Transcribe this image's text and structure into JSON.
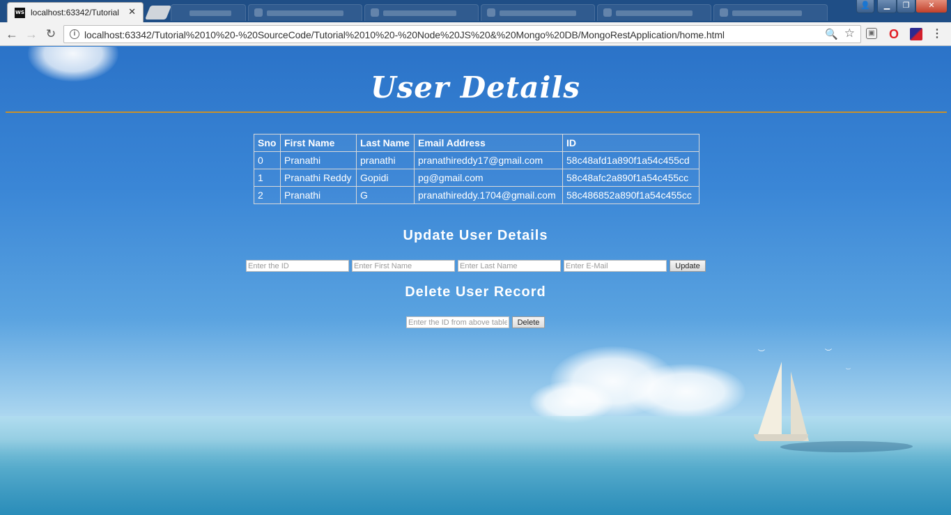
{
  "browser": {
    "active_tab": {
      "title": "localhost:63342/Tutorial",
      "favicon": "WS"
    },
    "url": "localhost:63342/Tutorial%2010%20-%20SourceCode/Tutorial%2010%20-%20Node%20JS%20&%20Mongo%20DB/MongoRestApplication/home.html",
    "icons": [
      "back-arrow-icon",
      "forward-arrow-icon",
      "reload-icon",
      "info-icon",
      "zoom-icon",
      "bookmark-star-icon",
      "opera-icon",
      "menu-icon"
    ]
  },
  "page": {
    "title": "User Details",
    "table": {
      "headers": [
        "Sno",
        "First Name",
        "Last Name",
        "Email Address",
        "ID"
      ],
      "rows": [
        [
          "0",
          "Pranathi",
          "pranathi",
          "pranathireddy17@gmail.com",
          "58c48afd1a890f1a54c455cd"
        ],
        [
          "1",
          "Pranathi Reddy",
          "Gopidi",
          "pg@gmail.com",
          "58c48afc2a890f1a54c455cc"
        ],
        [
          "2",
          "Pranathi",
          "G",
          "pranathireddy.1704@gmail.com",
          "58c486852a890f1a54c455cc"
        ]
      ]
    },
    "update": {
      "title": "Update User Details",
      "id_placeholder": "Enter the ID",
      "first_name_placeholder": "Enter First Name",
      "last_name_placeholder": "Enter Last Name",
      "email_placeholder": "E-Mail",
      "email_placeholder_full": "Enter E-Mail",
      "button": "Update"
    },
    "delete": {
      "title": "Delete User Record",
      "id_placeholder": "Enter the ID from above table",
      "button": "Delete"
    }
  }
}
